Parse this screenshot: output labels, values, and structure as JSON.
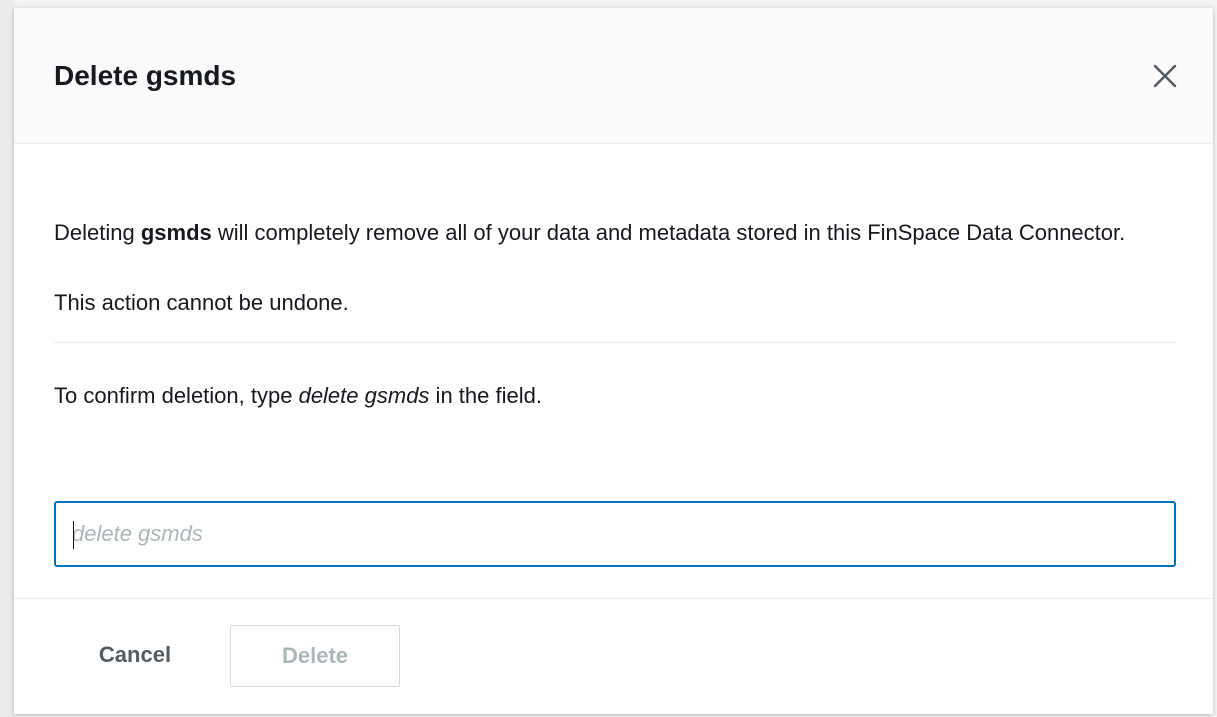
{
  "modal": {
    "title": "Delete gsmds",
    "close_icon": "close-icon",
    "description_prefix": "Deleting ",
    "resource_name": "gsmds",
    "description_suffix": " will completely remove all of your data and metadata stored in this FinSpace Data Connector.",
    "warning": "This action cannot be undone.",
    "confirm_prefix": "To confirm deletion, type ",
    "confirm_phrase": "delete gsmds",
    "confirm_suffix": " in the field.",
    "input": {
      "value": "",
      "placeholder": "delete gsmds"
    },
    "footer": {
      "cancel_label": "Cancel",
      "delete_label": "Delete",
      "delete_disabled": true
    }
  },
  "colors": {
    "focus_border": "#0073bb",
    "text": "#16191f",
    "muted": "#545b64",
    "disabled": "#aab7b8"
  }
}
